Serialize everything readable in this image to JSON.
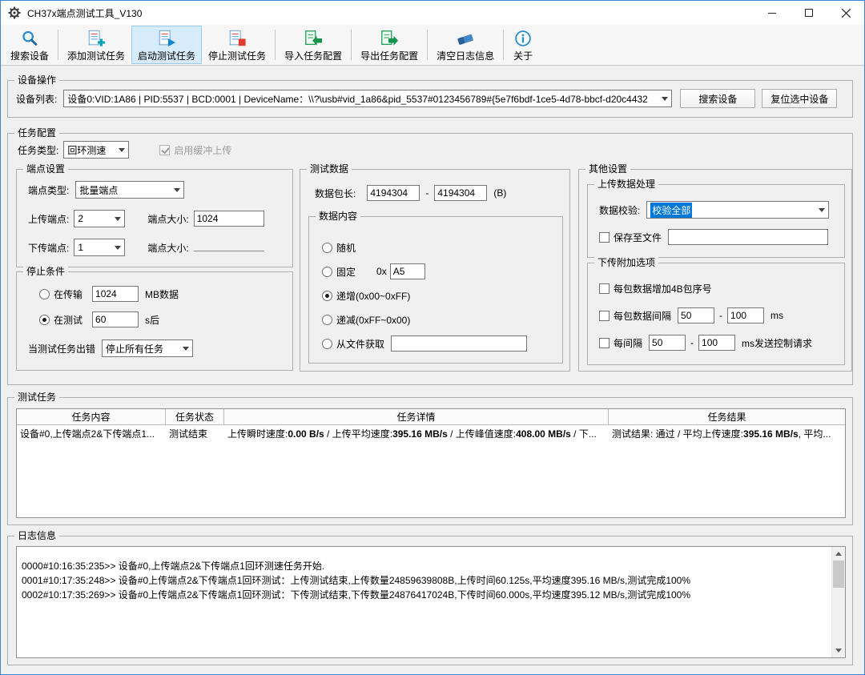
{
  "colors": {
    "accent": "#0078d7",
    "toolbar_active_bg": "#d7ecfa",
    "selection_bg": "#0078d7",
    "window_bg": "#f0f0f0"
  },
  "window": {
    "title": "CH37x端点测试工具_V130"
  },
  "toolbar": {
    "buttons": [
      {
        "label": "搜索设备",
        "icon": "search-icon"
      },
      {
        "label": "添加测试任务",
        "icon": "add-task-icon"
      },
      {
        "label": "启动测试任务",
        "icon": "start-task-icon",
        "active": true
      },
      {
        "label": "停止测试任务",
        "icon": "stop-task-icon"
      },
      {
        "label": "导入任务配置",
        "icon": "import-config-icon"
      },
      {
        "label": "导出任务配置",
        "icon": "export-config-icon"
      },
      {
        "label": "清空日志信息",
        "icon": "clear-log-icon"
      },
      {
        "label": "关于",
        "icon": "about-icon"
      }
    ]
  },
  "device": {
    "group_title": "设备操作",
    "list_label": "设备列表:",
    "selected_device": "设备0:VID:1A86 | PID:5537 | BCD:0001 | DeviceName：\\\\?\\usb#vid_1a86&pid_5537#0123456789#{5e7f6bdf-1ce5-4d78-bbcf-d20c4432",
    "search_button": "搜索设备",
    "reset_button": "复位选中设备"
  },
  "task_config": {
    "group_title": "任务配置",
    "task_type_label": "任务类型:",
    "task_type_value": "回环测速",
    "buffered_upload_label": "启用缓冲上传",
    "endpoint": {
      "group_title": "端点设置",
      "type_label": "端点类型:",
      "type_value": "批量端点",
      "upload_label": "上传端点:",
      "upload_value": "2",
      "upload_size_label": "端点大小:",
      "upload_size_value": "1024",
      "download_label": "下传端点:",
      "download_value": "1",
      "download_size_label": "端点大小:"
    },
    "stop": {
      "group_title": "停止条件",
      "transfer_label": "在传输",
      "transfer_value": "1024",
      "transfer_unit": "MB数据",
      "duration_label": "在测试",
      "duration_value": "60",
      "duration_unit": "s后",
      "on_error_label": "当测试任务出错",
      "on_error_value": "停止所有任务"
    },
    "test_data": {
      "group_title": "测试数据",
      "packet_label": "数据包长:",
      "packet_min": "4194304",
      "packet_sep": "-",
      "packet_max": "4194304",
      "packet_unit": "(B)",
      "content": {
        "group_title": "数据内容",
        "random_label": "随机",
        "fixed_label": "固定",
        "fixed_prefix": "0x",
        "fixed_value": "A5",
        "increment_label": "递增(0x00~0xFF)",
        "decrement_label": "递减(0xFF~0x00)",
        "from_file_label": "从文件获取",
        "file_value": ""
      }
    },
    "other": {
      "group_title": "其他设置",
      "upload_processing": {
        "group_title": "上传数据处理",
        "verify_label": "数据校验:",
        "verify_value": "校验全部",
        "save_file_label": "保存至文件",
        "save_file_value": ""
      },
      "download_options": {
        "group_title": "下传附加选项",
        "seq_label": "每包数据增加4B包序号",
        "gap_label": "每包数据间隔",
        "gap_min": "50",
        "gap_sep": "-",
        "gap_max": "100",
        "gap_unit": "ms",
        "ctrl_label": "每间隔",
        "ctrl_min": "50",
        "ctrl_sep": "-",
        "ctrl_max": "100",
        "ctrl_unit": "ms发送控制请求"
      }
    }
  },
  "tasks": {
    "group_title": "测试任务",
    "columns": [
      "任务内容",
      "任务状态",
      "任务详情",
      "任务结果"
    ],
    "row": {
      "content": "设备#0,上传端点2&下传端点1...",
      "status": "测试结束",
      "detail_segments": [
        {
          "text": "上传瞬时速度:"
        },
        {
          "text": "0.00 B/s",
          "bold": true
        },
        {
          "text": " / 上传平均速度:"
        },
        {
          "text": "395.16 MB/s",
          "bold": true
        },
        {
          "text": " / 上传峰值速度:"
        },
        {
          "text": "408.00 MB/s",
          "bold": true
        },
        {
          "text": " / 下..."
        }
      ],
      "result_segments": [
        {
          "text": "测试结果: 通过 / 平均上传速度:"
        },
        {
          "text": "395.16 MB/s",
          "bold": true
        },
        {
          "text": ", 平均..."
        }
      ]
    }
  },
  "log": {
    "group_title": "日志信息",
    "lines": [
      "0000#10:16:35:235>> 设备#0,上传端点2&下传端点1回环测速任务开始.",
      "0001#10:17:35:248>> 设备#0上传端点2&下传端点1回环测试：上传测试结束,上传数量24859639808B,上传时间60.125s,平均速度395.16 MB/s,测试完成100%",
      "0002#10:17:35:269>> 设备#0上传端点2&下传端点1回环测试：下传测试结束,下传数量24876417024B,下传时间60.000s,平均速度395.12 MB/s,测试完成100%"
    ]
  }
}
